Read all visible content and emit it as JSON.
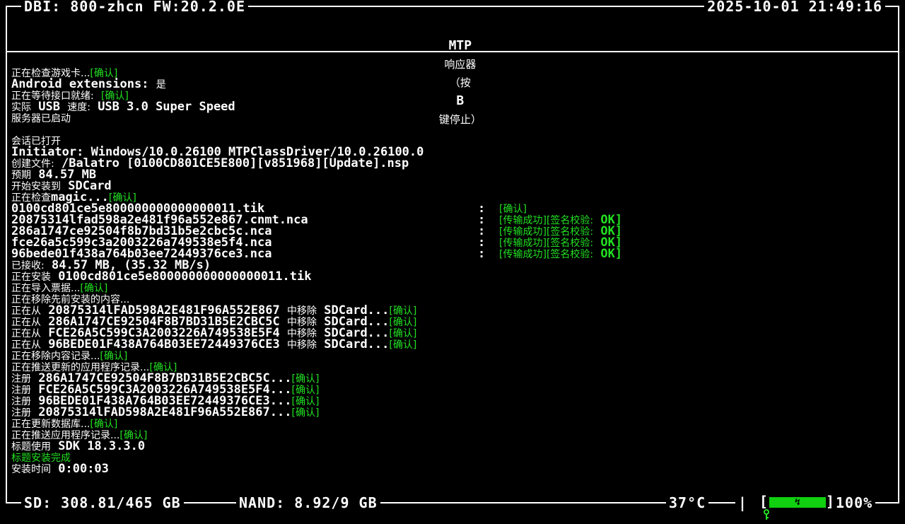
{
  "header": {
    "left": "DBI: 800-zhcn FW:20.2.0E",
    "right": "2025-10-01 21:49:16"
  },
  "title": {
    "mtp": "MTP",
    "responder": "响应器",
    "paren_open": "（按",
    "key": "B",
    "stop": "键停止）"
  },
  "log": {
    "l1_label": "正在检查游戏卡...",
    "l1_status": "[确认]",
    "l2_label": "Android extensions:",
    "l2_value": "是",
    "l3_label": "正在等待接口就绪:",
    "l3_status": "[确认]",
    "l4_a": "实际",
    "l4_b": "USB",
    "l4_c": "速度:",
    "l4_d": "USB 3.0 Super Speed",
    "l5": "服务器已启动",
    "l6": "会话已打开",
    "l7": "Initiator: Windows/10.0.26100 MTPClassDriver/10.0.26100.0",
    "l8_label": "创建文件:",
    "l8_value": "/Balatro [0100CD801CE5E800][v851968][Update].nsp",
    "l9_label": "预期",
    "l9_value": "84.57 MB",
    "l10_label": "开始安装到",
    "l10_value": "SDCard",
    "l11_label": "正在检查",
    "l11_value": "magic...",
    "l11_status": "[确认]",
    "files": [
      {
        "name": "0100cd801ce5e800000000000000011.tik",
        "sep": ":",
        "status": "[确认]",
        "verify": "",
        "ok": ""
      },
      {
        "name": "20875314lfad598a2e481f96a552e867.cnmt.nca",
        "sep": ":",
        "status": "[传输成功]",
        "verify": "[签名校验:",
        "ok": "OK]"
      },
      {
        "name": "286a1747ce92504f8b7bd31b5e2cbc5c.nca",
        "sep": ":",
        "status": "[传输成功]",
        "verify": "[签名校验:",
        "ok": "OK]"
      },
      {
        "name": "fce26a5c599c3a2003226a749538e5f4.nca",
        "sep": ":",
        "status": "[传输成功]",
        "verify": "[签名校验:",
        "ok": "OK]"
      },
      {
        "name": "96bede01f438a764b03ee72449376ce3.nca",
        "sep": ":",
        "status": "[传输成功]",
        "verify": "[签名校验:",
        "ok": "OK]"
      }
    ],
    "l17_label": "已接收:",
    "l17_value": "84.57 MB, (35.32 MB/s)",
    "l18_label": "正在安装",
    "l18_value": "0100cd801ce5e800000000000000011.tik",
    "l19_label": "正在导入票据...",
    "l19_status": "[确认]",
    "l20": "正在移除先前安装的内容...",
    "removes": [
      {
        "pre": "正在从",
        "id": "20875314lFAD598A2E481F96A552E867",
        "mid": "中移除",
        "dest": "SDCard...",
        "status": "[确认]"
      },
      {
        "pre": "正在从",
        "id": "286A1747CE92504F8B7BD31B5E2CBC5C",
        "mid": "中移除",
        "dest": "SDCard...",
        "status": "[确认]"
      },
      {
        "pre": "正在从",
        "id": "FCE26A5C599C3A2003226A749538E5F4",
        "mid": "中移除",
        "dest": "SDCard...",
        "status": "[确认]"
      },
      {
        "pre": "正在从",
        "id": "96BEDE01F438A764B03EE72449376CE3",
        "mid": "中移除",
        "dest": "SDCard...",
        "status": "[确认]"
      }
    ],
    "l25_label": "正在移除内容记录...",
    "l25_status": "[确认]",
    "l26_label": "正在推送更新的应用程序记录...",
    "l26_status": "[确认]",
    "registers": [
      {
        "pre": "注册",
        "id": "286A1747CE92504F8B7BD31B5E2CBC5C...",
        "status": "[确认]"
      },
      {
        "pre": "注册",
        "id": "FCE26A5C599C3A2003226A749538E5F4...",
        "status": "[确认]"
      },
      {
        "pre": "注册",
        "id": "96BEDE01F438A764B03EE72449376CE3...",
        "status": "[确认]"
      },
      {
        "pre": "注册",
        "id": "20875314lFAD598A2E481F96A552E867...",
        "status": "[确认]"
      }
    ],
    "l31_label": "正在更新数据库...",
    "l31_status": "[确认]",
    "l32_label": "正在推送应用程序记录...",
    "l32_status": "[确认]",
    "l33_label": "标题使用",
    "l33_value": "SDK 18.3.3.0",
    "l34": "标题安装完成",
    "l35_label": "安装时间",
    "l35_value": "0:00:03"
  },
  "footer": {
    "storage": "SD: 308.81/465 GB",
    "nand": "NAND: 8.92/9 GB",
    "temp": "37°C",
    "sep": "|",
    "bt_icon": "key-icon",
    "bat_open": "[",
    "bat_glyph": "↯",
    "bat_close": "]",
    "battery_level": 1.0,
    "battery": "100%"
  },
  "colors": {
    "background": "#000000",
    "text": "#ffffff",
    "ok_green": "#22e022",
    "battery_green": "#10d010"
  }
}
